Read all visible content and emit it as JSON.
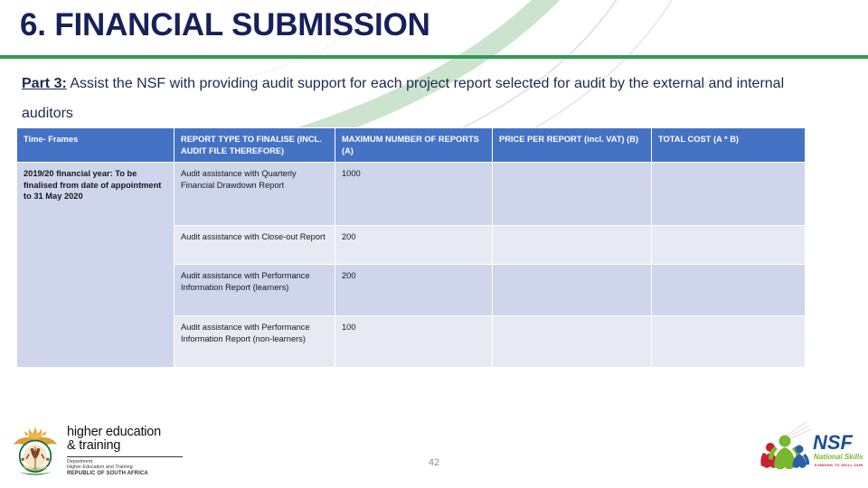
{
  "slide": {
    "title": "6. FINANCIAL SUBMISSION",
    "page_number": "42",
    "accent_green": "#2E9B57",
    "title_navy": "#16215B",
    "table_header_blue": "#4472C4",
    "band_dark": "#CFD5EA",
    "band_light": "#E8EAF3"
  },
  "body": {
    "lead": "Part 3:",
    "paragraph": " Assist the NSF with providing audit support for each project report selected for audit by the external and internal auditors"
  },
  "table": {
    "headers": [
      "Time- Frames",
      "REPORT TYPE TO FINALISE (INCL. AUDIT FILE THEREFORE)",
      "MAXIMUM NUMBER OF REPORTS (A)",
      "PRICE PER REPORT (incl. VAT) (B)",
      "TOTAL COST (A * B)"
    ],
    "timeframe_cell": "2019/20 financial year: To be finalised from date of appointment to 31 May 2020",
    "rows": [
      {
        "report_type": "Audit assistance with Quarterly Financial Drawdown Report",
        "max_reports": "1000",
        "price_per_report": "",
        "total_cost": ""
      },
      {
        "report_type": "Audit assistance with Close-out Report",
        "max_reports": "200",
        "price_per_report": "",
        "total_cost": ""
      },
      {
        "report_type": "Audit assistance with Performance Information Report (learners)",
        "max_reports": "200",
        "price_per_report": "",
        "total_cost": ""
      },
      {
        "report_type": "Audit assistance with Performance Information Report (non-learners)",
        "max_reports": "100",
        "price_per_report": "",
        "total_cost": ""
      }
    ]
  },
  "footer": {
    "dhet": {
      "line1": "higher education",
      "line2": "& training",
      "dept": "Department:",
      "dept2": "Higher Education and Training",
      "country": "REPUBLIC OF SOUTH AFRICA"
    },
    "nsf": {
      "acronym": "NSF",
      "name": "National Skills Fund",
      "tagline": "FUNDING TO SKILL OUR NATION"
    }
  }
}
